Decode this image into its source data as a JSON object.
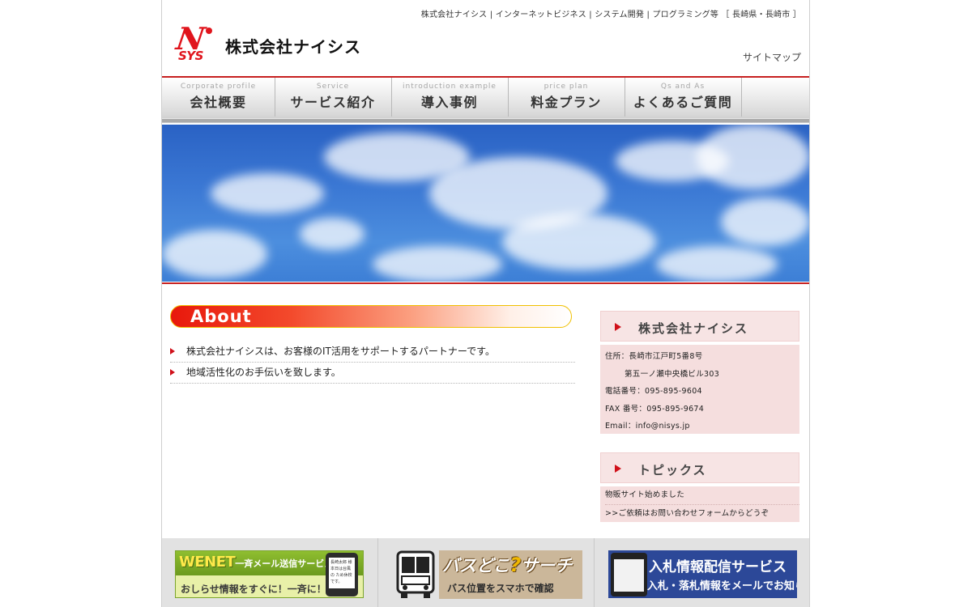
{
  "header": {
    "tagline": "株式会社ナイシス | インターネットビジネス | システム開発 | プログラミング等 ［ 長崎県・長崎市 ］",
    "logo_letter": "N",
    "logo_sub": "SYS",
    "company_name": "株式会社ナイシス",
    "sitemap_label": "サイトマップ"
  },
  "nav": {
    "items": [
      {
        "en": "Corporate profile",
        "jp": "会社概要"
      },
      {
        "en": "Service",
        "jp": "サービス紹介"
      },
      {
        "en": "introduction example",
        "jp": "導入事例"
      },
      {
        "en": "price plan",
        "jp": "料金プラン"
      },
      {
        "en": "Qs and As",
        "jp": "よくあるご質問"
      }
    ]
  },
  "about": {
    "heading": "About",
    "items": [
      "株式会社ナイシスは、お客様のIT活用をサポートするパートナーです。",
      "地域活性化のお手伝いを致します。"
    ]
  },
  "company_box": {
    "heading": "株式会社ナイシス",
    "address_line1": "住所：長崎市江戸町5番8号",
    "address_line2": "第五一ノ瀬中央橋ビル303",
    "phone": "電話番号：095-895-9604",
    "fax": "FAX 番号：095-895-9674",
    "email": "Email：info@nisys.jp"
  },
  "topics": {
    "heading": "トピックス",
    "items": [
      "物販サイト始めました",
      ">>ご依頼はお問い合わせフォームからどうぞ"
    ]
  },
  "footer_banners": {
    "wenet": {
      "title": "WENET",
      "title_suffix": "一斉メール送信サービス",
      "subtitle": "おしらせ情報をすぐに！一斉に！",
      "phone_text": "長崎太郎 様 本日は台風の ため休校です。"
    },
    "bus": {
      "title_a": "バスどこ",
      "title_q": "?",
      "title_b": "サーチ",
      "subtitle": "バス位置をスマホで確認"
    },
    "nyusatsu": {
      "title": "入札情報配信サービス",
      "subtitle": "入札・落札情報をメールでお知らせ"
    }
  },
  "colors": {
    "accent_red": "#d0101a",
    "side_box_bg": "#f5dede",
    "sky_blue": "#3b78d4"
  }
}
